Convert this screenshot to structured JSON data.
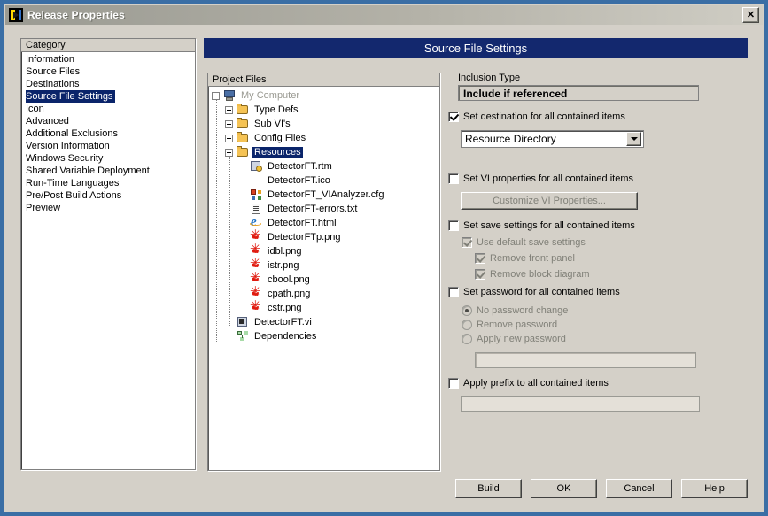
{
  "window": {
    "title": "Release Properties",
    "close_label": "✕",
    "icon": "labview-vi-icon"
  },
  "banner": {
    "title": "Source File Settings"
  },
  "category": {
    "header": "Category",
    "selected": "Source File Settings",
    "items": [
      "Information",
      "Source Files",
      "Destinations",
      "Source File Settings",
      "Icon",
      "Advanced",
      "Additional Exclusions",
      "Version Information",
      "Windows Security",
      "Shared Variable Deployment",
      "Run-Time Languages",
      "Pre/Post Build Actions",
      "Preview"
    ]
  },
  "tree": {
    "header": "Project Files",
    "nodes": [
      {
        "label": "My Computer",
        "icon": "computer-icon",
        "depth": 0,
        "twisty": "minus",
        "dim": true,
        "selected": false
      },
      {
        "label": "Type Defs",
        "icon": "folder-icon",
        "depth": 1,
        "twisty": "plus",
        "dim": false,
        "selected": false
      },
      {
        "label": "Sub VI's",
        "icon": "folder-icon",
        "depth": 1,
        "twisty": "plus",
        "dim": false,
        "selected": false
      },
      {
        "label": "Config Files",
        "icon": "folder-icon",
        "depth": 1,
        "twisty": "plus",
        "dim": false,
        "selected": false
      },
      {
        "label": "Resources",
        "icon": "folder-icon",
        "depth": 1,
        "twisty": "minus",
        "dim": false,
        "selected": true
      },
      {
        "label": "DetectorFT.rtm",
        "icon": "rtm-file-icon",
        "depth": 2,
        "twisty": "none",
        "dim": false,
        "selected": false
      },
      {
        "label": "DetectorFT.ico",
        "icon": "blank-icon",
        "depth": 2,
        "twisty": "none",
        "dim": false,
        "selected": false
      },
      {
        "label": "DetectorFT_VIAnalyzer.cfg",
        "icon": "cfg-file-icon",
        "depth": 2,
        "twisty": "none",
        "dim": false,
        "selected": false
      },
      {
        "label": "DetectorFT-errors.txt",
        "icon": "txt-file-icon",
        "depth": 2,
        "twisty": "none",
        "dim": false,
        "selected": false
      },
      {
        "label": "DetectorFT.html",
        "icon": "html-file-icon",
        "depth": 2,
        "twisty": "none",
        "dim": false,
        "selected": false
      },
      {
        "label": "DetectorFTp.png",
        "icon": "png-file-icon",
        "depth": 2,
        "twisty": "none",
        "dim": false,
        "selected": false
      },
      {
        "label": "idbl.png",
        "icon": "png-file-icon",
        "depth": 2,
        "twisty": "none",
        "dim": false,
        "selected": false
      },
      {
        "label": "istr.png",
        "icon": "png-file-icon",
        "depth": 2,
        "twisty": "none",
        "dim": false,
        "selected": false
      },
      {
        "label": "cbool.png",
        "icon": "png-file-icon",
        "depth": 2,
        "twisty": "none",
        "dim": false,
        "selected": false
      },
      {
        "label": "cpath.png",
        "icon": "png-file-icon",
        "depth": 2,
        "twisty": "none",
        "dim": false,
        "selected": false
      },
      {
        "label": "cstr.png",
        "icon": "png-file-icon",
        "depth": 2,
        "twisty": "none",
        "dim": false,
        "selected": false
      },
      {
        "label": "DetectorFT.vi",
        "icon": "vi-file-icon",
        "depth": 1,
        "twisty": "none",
        "dim": false,
        "selected": false
      },
      {
        "label": "Dependencies",
        "icon": "dependencies-icon",
        "depth": 1,
        "twisty": "none",
        "dim": false,
        "selected": false
      }
    ]
  },
  "settings": {
    "inclusion_type_label": "Inclusion Type",
    "inclusion_type_value": "Include if referenced",
    "set_destination_label": "Set destination for all contained items",
    "set_destination_checked": true,
    "destination_value": "Resource Directory",
    "set_vi_properties_label": "Set VI properties for all contained items",
    "set_vi_properties_checked": false,
    "customize_vi_properties_label": "Customize VI Properties...",
    "set_save_settings_label": "Set save settings for all contained items",
    "set_save_settings_checked": false,
    "use_default_save_label": "Use default save settings",
    "use_default_save_checked": true,
    "remove_front_panel_label": "Remove front panel",
    "remove_front_panel_checked": true,
    "remove_block_diagram_label": "Remove block diagram",
    "remove_block_diagram_checked": true,
    "set_password_label": "Set password for all contained items",
    "set_password_checked": false,
    "password_options": [
      {
        "label": "No password change",
        "selected": true
      },
      {
        "label": "Remove password",
        "selected": false
      },
      {
        "label": "Apply new password",
        "selected": false
      }
    ],
    "password_value": "",
    "apply_prefix_label": "Apply prefix to all contained items",
    "apply_prefix_checked": false,
    "prefix_value": ""
  },
  "buttons": {
    "build": "Build",
    "ok": "OK",
    "cancel": "Cancel",
    "help": "Help"
  },
  "colors": {
    "desktop": "#3a6ea5",
    "dialog_face": "#d4d0c8",
    "banner_blue": "#13286e",
    "selection_blue": "#0a246a",
    "disabled_text": "#808078"
  }
}
